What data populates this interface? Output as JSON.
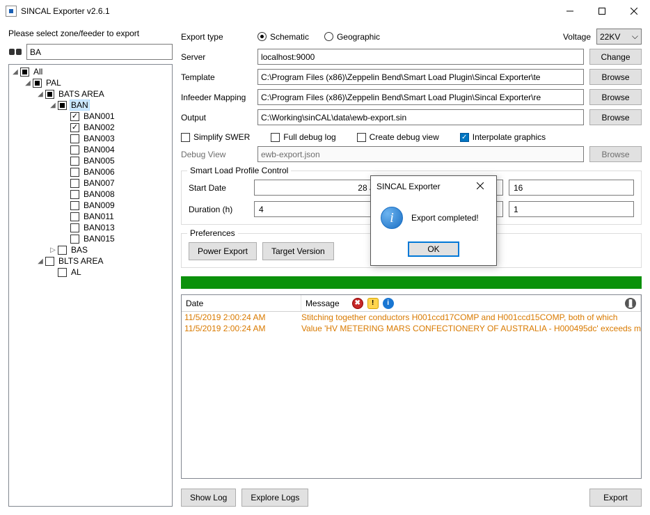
{
  "window": {
    "title": "SINCAL Exporter v2.6.1"
  },
  "left": {
    "instruction": "Please select zone/feeder to export",
    "search_value": "BA",
    "tree": {
      "root": "All",
      "n1": "PAL",
      "n2": "BATS AREA",
      "n3": "BAN",
      "items": [
        "BAN001",
        "BAN002",
        "BAN003",
        "BAN004",
        "BAN005",
        "BAN006",
        "BAN007",
        "BAN008",
        "BAN009",
        "BAN011",
        "BAN013",
        "BAN015"
      ],
      "n4": "BAS",
      "n5": "BLTS AREA",
      "n6": "AL"
    }
  },
  "right": {
    "export_type_label": "Export type",
    "schematic_label": "Schematic",
    "geographic_label": "Geographic",
    "voltage_label": "Voltage",
    "voltage_value": "22KV",
    "server_label": "Server",
    "server_value": "localhost:9000",
    "change_label": "Change",
    "template_label": "Template",
    "template_value": "C:\\Program Files (x86)\\Zeppelin Bend\\Smart Load Plugin\\Sincal Exporter\\te",
    "infeeder_label": "Infeeder Mapping",
    "infeeder_value": "C:\\Program Files (x86)\\Zeppelin Bend\\Smart Load Plugin\\Sincal Exporter\\re",
    "output_label": "Output",
    "output_value": "C:\\Working\\sinCAL\\data\\ewb-export.sin",
    "browse_label": "Browse",
    "simplify_swer_label": "Simplify SWER",
    "full_debug_label": "Full debug log",
    "create_debug_view_label": "Create debug view",
    "interpolate_label": "Interpolate graphics",
    "debug_view_label": "Debug View",
    "debug_view_value": "ewb-export.json",
    "profile": {
      "legend": "Smart Load Profile Control",
      "start_date_label": "Start Date",
      "start_date_value": "28 January",
      "extra_value": "16",
      "duration_label": "Duration (h)",
      "duration_value": "4",
      "extra2_value": "1"
    },
    "prefs": {
      "legend": "Preferences",
      "power_export": "Power Export",
      "target_version": "Target Version"
    }
  },
  "log": {
    "date_header": "Date",
    "message_header": "Message",
    "rows": [
      {
        "date": "11/5/2019 2:00:24 AM",
        "msg": "Stitching together conductors H001ccd17COMP and H001ccd15COMP, both of which"
      },
      {
        "date": "11/5/2019 2:00:24 AM",
        "msg": "Value 'HV METERING MARS CONFECTIONERY OF AUSTRALIA - H000495dc' exceeds m"
      }
    ]
  },
  "bottom": {
    "show_log": "Show Log",
    "explore_logs": "Explore Logs",
    "export": "Export"
  },
  "modal": {
    "title": "SINCAL Exporter",
    "message": "Export completed!",
    "ok": "OK"
  }
}
